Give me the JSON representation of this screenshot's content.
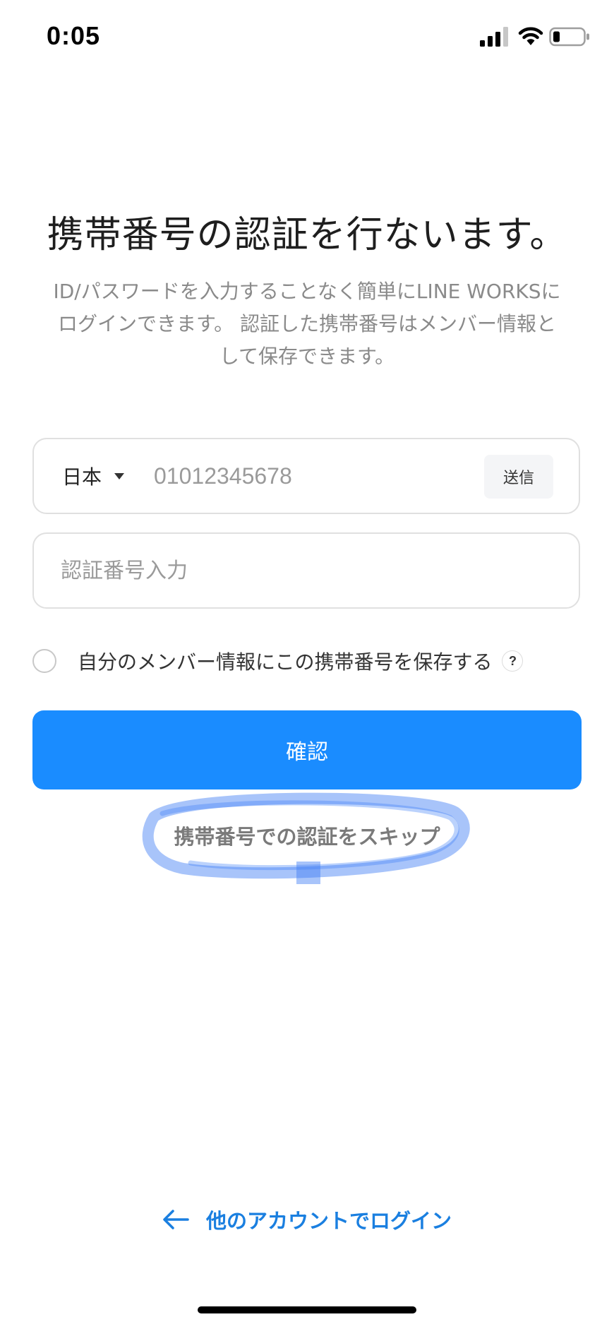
{
  "status_bar": {
    "time": "0:05",
    "signal_icon": "cellular-signal-icon",
    "wifi_icon": "wifi-icon",
    "battery_icon": "battery-low-icon"
  },
  "header": {
    "title": "携帯番号の認証を行ないます。",
    "description_lines": [
      "ID/パスワードを入力することなく簡単にLINE WORKSに",
      "ログインできます。 認証した携帯番号はメンバー情報と",
      "して保存できます。"
    ]
  },
  "phone_field": {
    "country": "日本",
    "placeholder": "01012345678",
    "send_label": "送信"
  },
  "code_field": {
    "placeholder": "認証番号入力"
  },
  "save_option": {
    "label": "自分のメンバー情報にこの携帯番号を保存する",
    "help": "?",
    "checked": false
  },
  "confirm_label": "確認",
  "skip_label": "携帯番号での認証をスキップ",
  "highlight_color": "#3d7df5",
  "accent_color": "#1a8cff",
  "other_login": {
    "label": "他のアカウントでログイン",
    "icon": "arrow-left-icon"
  }
}
